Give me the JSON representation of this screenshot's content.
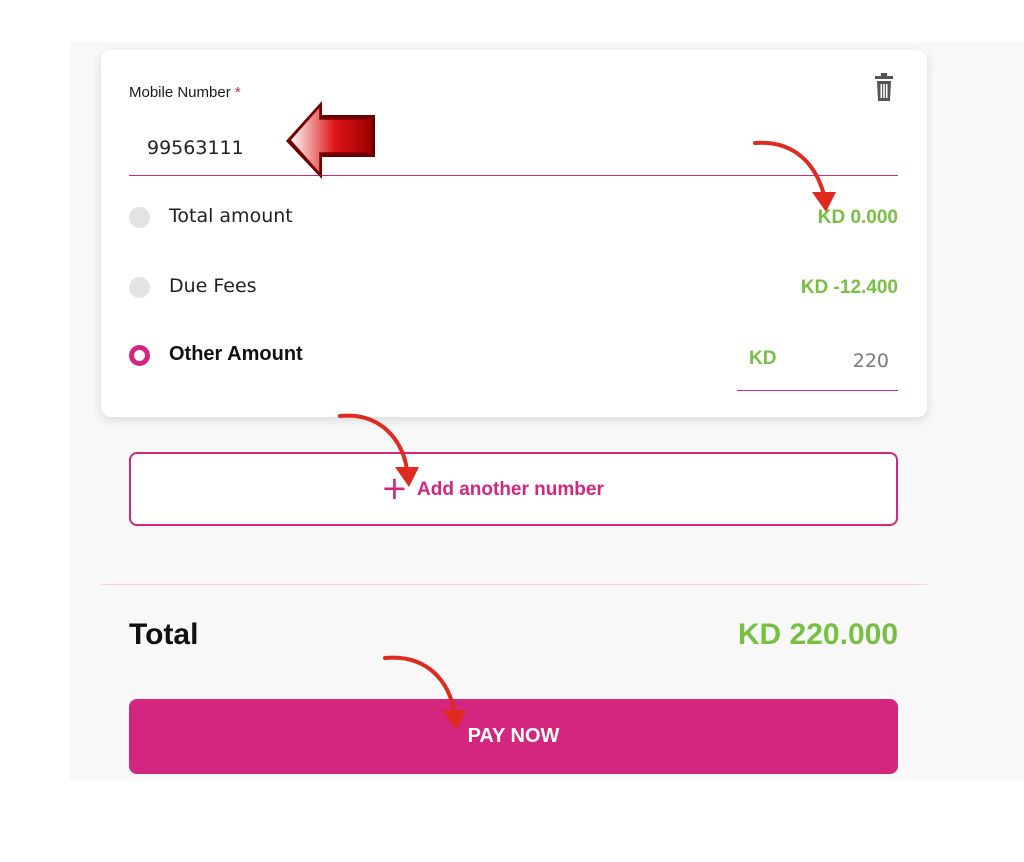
{
  "form": {
    "mobile_label": "Mobile Number",
    "required_mark": "*",
    "mobile_value": "99563111",
    "delete_icon": "trash-icon"
  },
  "options": [
    {
      "label": "Total amount",
      "amount": "KD 0.000",
      "selected": false
    },
    {
      "label": "Due Fees",
      "amount": "KD -12.400",
      "selected": false
    },
    {
      "label": "Other Amount",
      "currency": "KD",
      "value": "220",
      "selected": true
    }
  ],
  "add_number": {
    "icon": "plus-icon",
    "label": "Add another number"
  },
  "summary": {
    "total_label": "Total",
    "total_value": "KD 220.000"
  },
  "pay_button": {
    "label": "PAY NOW"
  },
  "colors": {
    "accent": "#d4267e",
    "amount_green": "#78c043",
    "annotation_red": "#e02a1f"
  }
}
